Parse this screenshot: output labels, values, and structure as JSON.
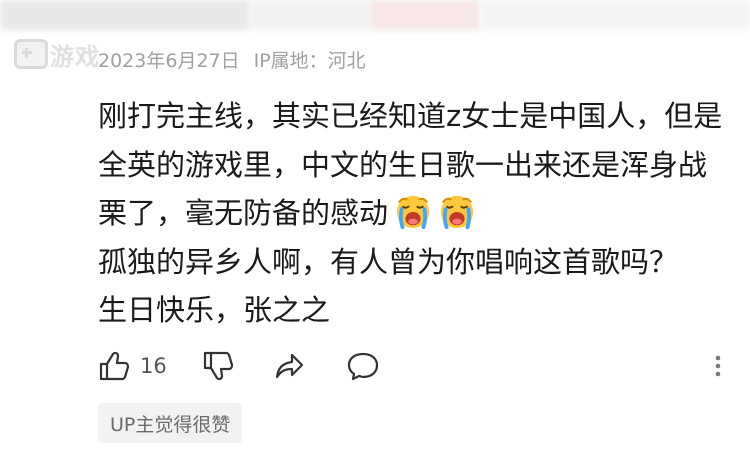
{
  "watermark": {
    "text": "游戏"
  },
  "comment": {
    "date": "2023年6月27日",
    "ip_location": "IP属地：河北",
    "lines": [
      "刚打完主线，其实已经知道z女士是中国人，但是",
      "全英的游戏里，中文的生日歌一出来还是浑身战",
      "栗了，毫无防备的感动",
      "孤独的异乡人啊，有人曾为你唱响这首歌吗？",
      "生日快乐，张之之"
    ],
    "emojis": [
      "crying-face-emoji",
      "crying-face-emoji"
    ]
  },
  "actions": {
    "like_count": "16",
    "icons": [
      "thumbs-up-icon",
      "thumbs-down-icon",
      "share-icon",
      "reply-icon",
      "more-vertical-icon"
    ]
  },
  "badge": {
    "label": "UP主觉得很赞"
  },
  "colors": {
    "meta_text": "#a0a0a0",
    "body_text": "#1a1a1a",
    "icon": "#333333",
    "badge_bg": "#f1f2f3"
  }
}
